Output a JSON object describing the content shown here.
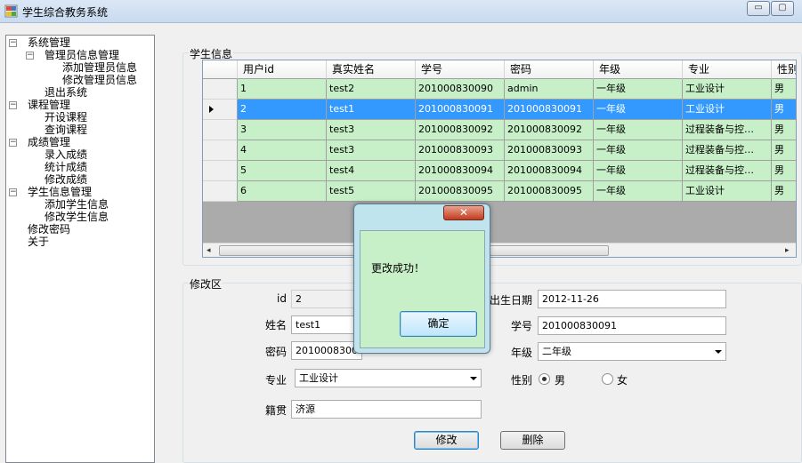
{
  "window": {
    "title": "学生综合教务系统",
    "min_glyph": "▭",
    "max_glyph": "▢"
  },
  "tree": {
    "items": [
      {
        "label": "系统管理",
        "level": 0,
        "toggle": "−"
      },
      {
        "label": "管理员信息管理",
        "level": 1,
        "toggle": "−"
      },
      {
        "label": "添加管理员信息",
        "level": 2
      },
      {
        "label": "修改管理员信息",
        "level": 2
      },
      {
        "label": "退出系统",
        "level": 1
      },
      {
        "label": "课程管理",
        "level": 0,
        "toggle": "−"
      },
      {
        "label": "开设课程",
        "level": 1
      },
      {
        "label": "查询课程",
        "level": 1
      },
      {
        "label": "成绩管理",
        "level": 0,
        "toggle": "−"
      },
      {
        "label": "录入成绩",
        "level": 1
      },
      {
        "label": "统计成绩",
        "level": 1
      },
      {
        "label": "修改成绩",
        "level": 1
      },
      {
        "label": "学生信息管理",
        "level": 0,
        "toggle": "−"
      },
      {
        "label": "添加学生信息",
        "level": 1
      },
      {
        "label": "修改学生信息",
        "level": 1
      },
      {
        "label": "修改密码",
        "level": 0
      },
      {
        "label": "关于",
        "level": 0
      }
    ]
  },
  "student_info": {
    "group_title": "学生信息",
    "columns": [
      "用户id",
      "真实姓名",
      "学号",
      "密码",
      "年级",
      "专业",
      "性别"
    ],
    "rows": [
      [
        "1",
        "test2",
        "201000830090",
        "admin",
        "一年级",
        "工业设计",
        "男"
      ],
      [
        "2",
        "test1",
        "201000830091",
        "201000830091",
        "一年级",
        "工业设计",
        "男"
      ],
      [
        "3",
        "test3",
        "201000830092",
        "201000830092",
        "一年级",
        "过程装备与控…",
        "男"
      ],
      [
        "4",
        "test3",
        "201000830093",
        "201000830093",
        "一年级",
        "过程装备与控…",
        "男"
      ],
      [
        "5",
        "test4",
        "201000830094",
        "201000830094",
        "一年级",
        "过程装备与控…",
        "男"
      ],
      [
        "6",
        "test5",
        "201000830095",
        "201000830095",
        "一年级",
        "工业设计",
        "男"
      ]
    ],
    "selected_row": 1
  },
  "edit": {
    "group_title": "修改区",
    "id_label": "id",
    "id_value": "2",
    "name_label": "姓名",
    "name_value": "test1",
    "password_label": "密码",
    "password_value": "201000830091",
    "major_label": "专业",
    "major_value": "工业设计",
    "origin_label": "籍贯",
    "origin_value": "济源",
    "birth_label": "出生日期",
    "birth_value": "2012-11-26",
    "student_no_label": "学号",
    "student_no_value": "201000830091",
    "grade_label": "年级",
    "grade_value": "二年级",
    "gender_label": "性别",
    "gender_male": "男",
    "gender_female": "女",
    "gender_selected": "男",
    "modify_button": "修改",
    "delete_button": "删除"
  },
  "dialog": {
    "message": "更改成功！",
    "ok_button": "确定",
    "close_glyph": "✕"
  },
  "colors": {
    "grid_row_bg": "#c8f0c8",
    "selected_row_bg": "#3399ff",
    "dialog_frame": "#bfe4ee",
    "close_button": "#c23b1f"
  }
}
